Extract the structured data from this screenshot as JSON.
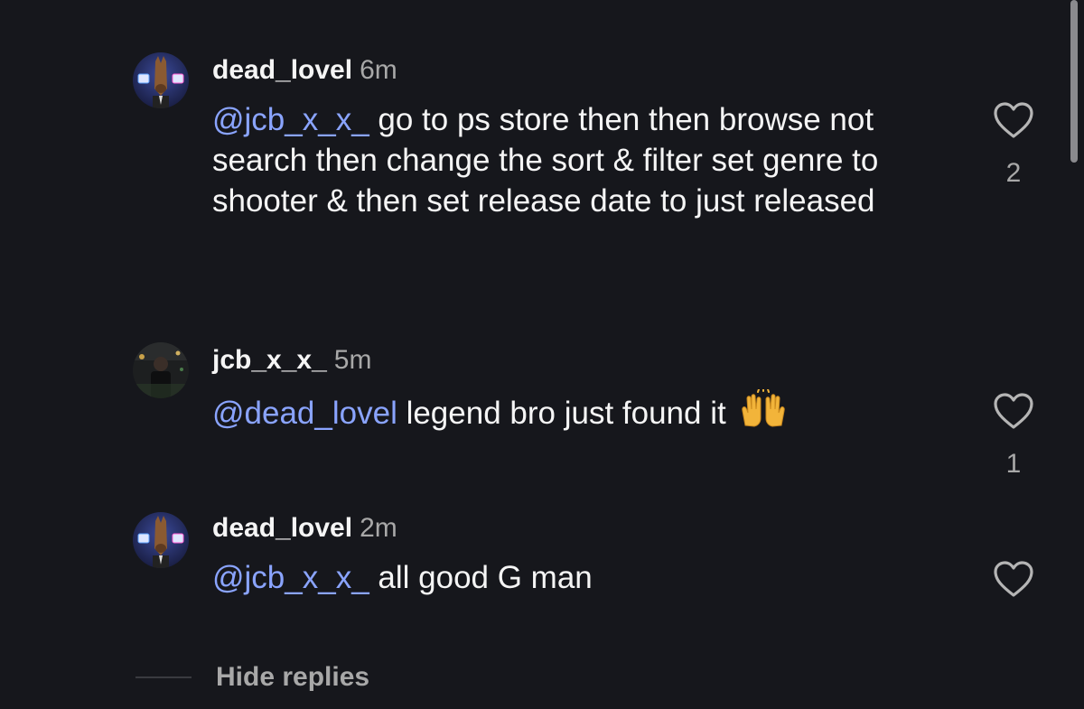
{
  "comments": [
    {
      "username": "dead_lovel",
      "time": "6m",
      "mention": "@jcb_x_x_",
      "text": " go to ps store then then browse not search  then change the sort & filter set genre to shooter & then set release date to just released",
      "likes": "2",
      "avatar": "horse-character-avatar"
    },
    {
      "username": "jcb_x_x_",
      "time": "5m",
      "mention": "@dead_lovel",
      "text": " legend bro just found it",
      "emoji": "raising-hands",
      "likes": "1",
      "avatar": "dark-photo-avatar"
    },
    {
      "username": "dead_lovel",
      "time": "2m",
      "mention": "@jcb_x_x_",
      "text": " all good G man",
      "likes": "",
      "avatar": "horse-character-avatar"
    }
  ],
  "hide_replies": "Hide replies",
  "colors": {
    "background": "#16171c",
    "mention": "#8aa4ff",
    "muted": "#a8a8a8",
    "text": "#f5f5f5"
  },
  "icons": [
    "heart-icon",
    "raising-hands-emoji"
  ]
}
